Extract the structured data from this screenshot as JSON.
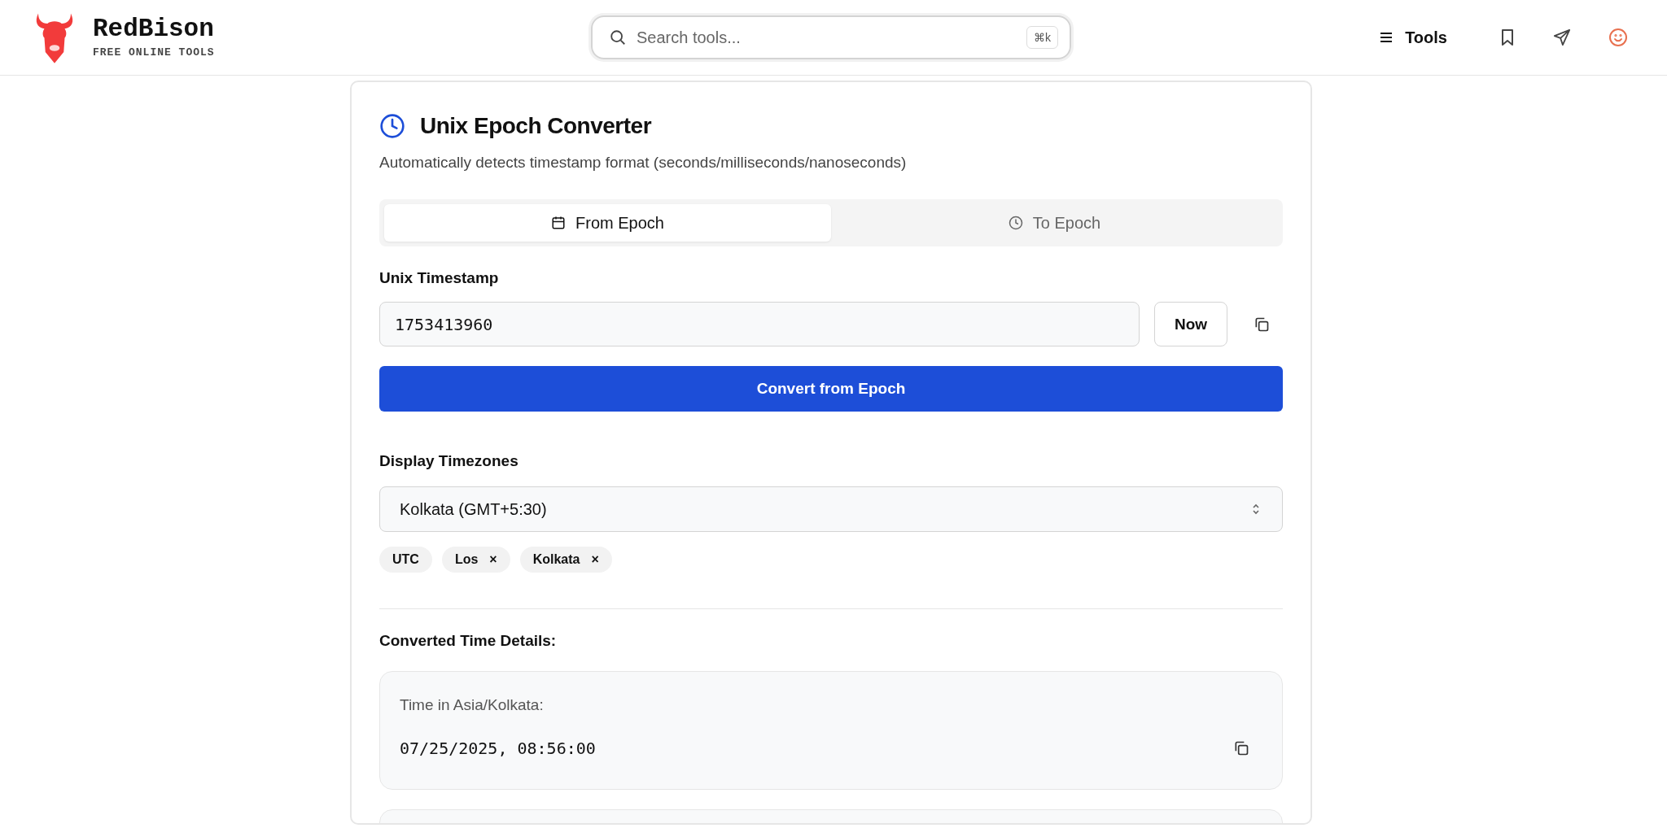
{
  "header": {
    "brand": "RedBison",
    "tagline": "FREE ONLINE TOOLS",
    "search": {
      "placeholder": "Search tools...",
      "shortcut": "⌘k"
    },
    "menu": "Tools"
  },
  "card": {
    "title": "Unix Epoch Converter",
    "subtitle": "Automatically detects timestamp format (seconds/milliseconds/nanoseconds)",
    "tabs": [
      {
        "label": "From Epoch",
        "kind": "calendar",
        "selected": true
      },
      {
        "label": "To Epoch",
        "kind": "clock",
        "selected": false
      }
    ],
    "timestamp": {
      "label": "Unix Timestamp",
      "value": "1753413960",
      "now_button": "Now"
    },
    "convert_button": "Convert from Epoch",
    "timezones": {
      "label": "Display Timezones",
      "value": "Kolkata (GMT+5:30)",
      "chips": [
        {
          "label": "UTC"
        },
        {
          "label": "Los",
          "remove": "×"
        },
        {
          "label": "Kolkata",
          "remove": "×"
        }
      ]
    },
    "details": {
      "label": "Converted Time Details:",
      "results": [
        {
          "caption": "Time in Asia/Kolkata:",
          "value": "07/25/2025, 08:56:00"
        }
      ]
    }
  }
}
